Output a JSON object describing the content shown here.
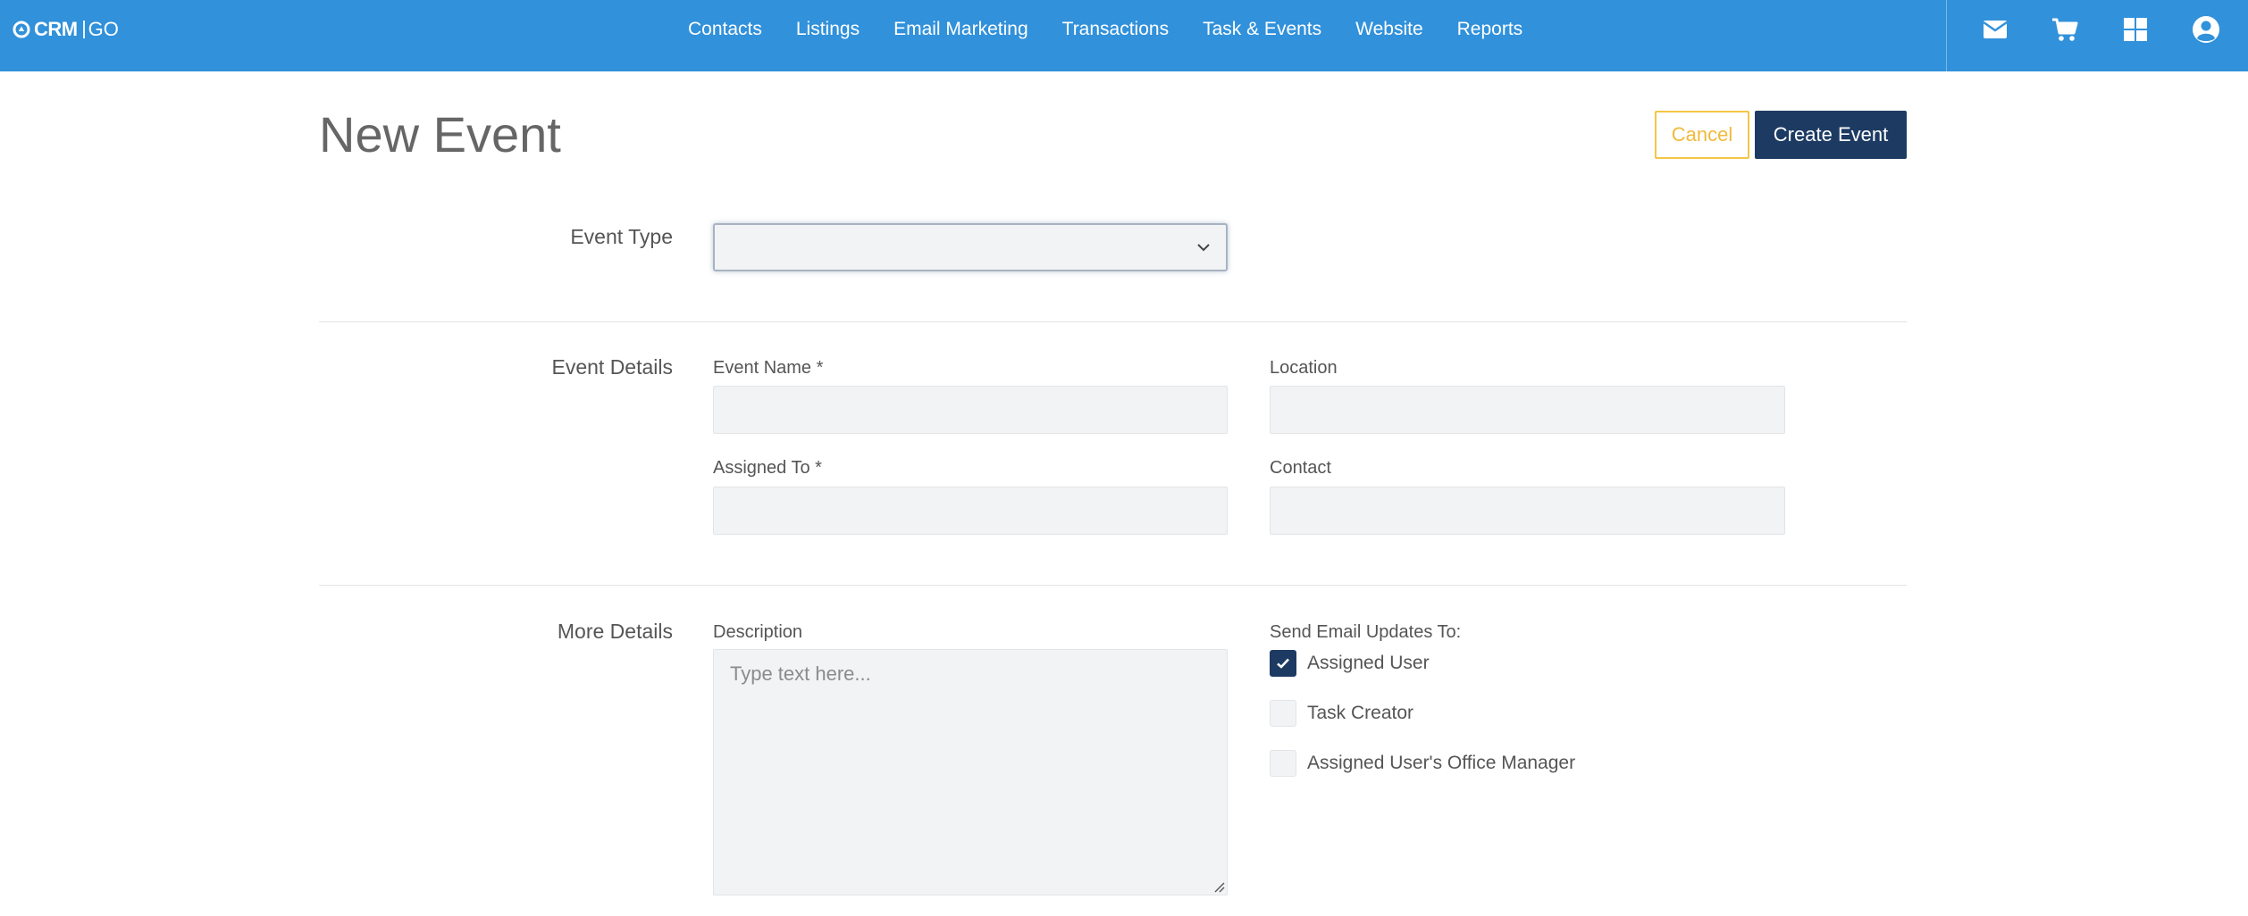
{
  "brand": {
    "crm": "CRM",
    "go": "GO"
  },
  "nav": [
    {
      "label": "Contacts"
    },
    {
      "label": "Listings"
    },
    {
      "label": "Email Marketing"
    },
    {
      "label": "Transactions"
    },
    {
      "label": "Task & Events"
    },
    {
      "label": "Website"
    },
    {
      "label": "Reports"
    }
  ],
  "topbar_icons": [
    "envelope-icon",
    "cart-icon",
    "apps-grid-icon",
    "user-account-icon"
  ],
  "colors": {
    "topbar": "#3191db",
    "primary": "#1d3b62",
    "cancel": "#f5c646"
  },
  "page": {
    "title": "New Event",
    "cancel_label": "Cancel",
    "create_label": "Create Event"
  },
  "event_type": {
    "label": "Event Type",
    "value": ""
  },
  "event_details": {
    "section_label": "Event Details",
    "event_name_label": "Event Name *",
    "event_name_value": "",
    "location_label": "Location",
    "location_value": "",
    "assigned_to_label": "Assigned To *",
    "assigned_to_value": "",
    "contact_label": "Contact",
    "contact_value": ""
  },
  "more_details": {
    "section_label": "More Details",
    "description_label": "Description",
    "description_placeholder": "Type text here...",
    "send_updates_label": "Send Email Updates To:",
    "options": [
      {
        "label": "Assigned User",
        "checked": true
      },
      {
        "label": "Task Creator",
        "checked": false
      },
      {
        "label": "Assigned User's Office Manager",
        "checked": false
      }
    ]
  }
}
